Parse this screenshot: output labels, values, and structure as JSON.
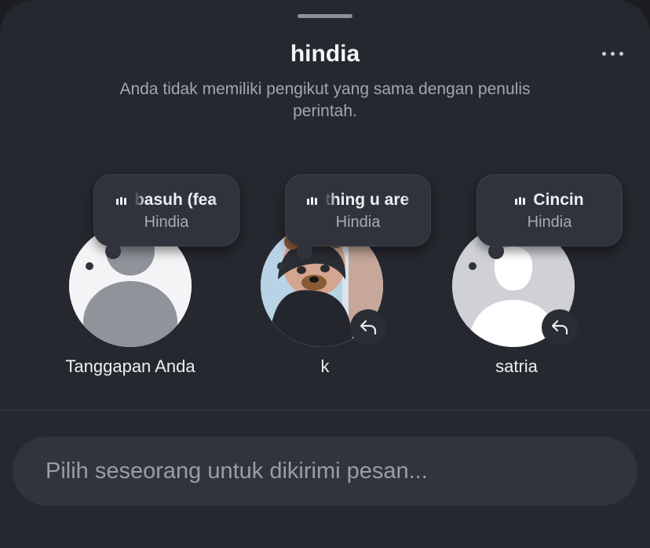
{
  "sheet": {
    "title": "hindia",
    "subtitle": "Anda tidak memiliki pengikut yang sama dengan penulis perintah.",
    "more_icon": "more-horizontal-icon"
  },
  "people": [
    {
      "name": "Tanggapan Anda",
      "note": {
        "song": "basuh (fea",
        "artist": "Hindia",
        "icon": "music-bars-icon"
      },
      "avatar": "default-avatar",
      "has_reply": false
    },
    {
      "name": "k",
      "note": {
        "song": "thing u are",
        "artist": "Hindia",
        "icon": "music-bars-icon"
      },
      "avatar": "photo-avatar",
      "has_reply": true
    },
    {
      "name": "satria",
      "note": {
        "song": "Cincin",
        "artist": "Hindia",
        "icon": "music-bars-icon"
      },
      "avatar": "silhouette-avatar",
      "has_reply": true
    }
  ],
  "composer": {
    "placeholder": "Pilih seseorang untuk dikirimi pesan..."
  },
  "colors": {
    "sheet_background": "#26282f",
    "note_background": "#30333b",
    "field_background": "#31343c",
    "text_primary": "#eef0f3",
    "text_secondary": "#a3a6ae"
  }
}
